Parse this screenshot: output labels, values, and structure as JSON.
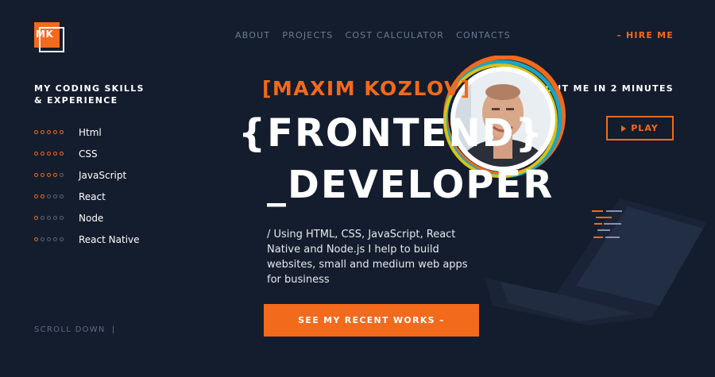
{
  "logo": {
    "text": "MK"
  },
  "nav": {
    "items": [
      "ABOUT",
      "PROJECTS",
      "COST CALCULATOR",
      "CONTACTS"
    ],
    "hire": "– HIRE ME"
  },
  "skills": {
    "title": "MY CODING SKILLS & EXPERIENCE",
    "items": [
      {
        "name": "Html",
        "level": 5
      },
      {
        "name": "CSS",
        "level": 5
      },
      {
        "name": "JavaScript",
        "level": 4
      },
      {
        "name": "React",
        "level": 2
      },
      {
        "name": "Node",
        "level": 1
      },
      {
        "name": "React Native",
        "level": 1
      }
    ],
    "max_level": 5
  },
  "scroll": {
    "label": "SCROLL DOWN",
    "bar": "|"
  },
  "about": {
    "title": "ABOUT ME IN 2 MINUTES",
    "play": "PLAY"
  },
  "hero": {
    "name": "[MAXIM KOZLOV]",
    "line1": "{FRONTEND}",
    "line2": "_DEVELOPER",
    "description": "/ Using HTML, CSS, JavaScript, React Native and Node.js I help to build websites, small and medium web apps for business",
    "cta": "SEE MY RECENT WORKS –"
  },
  "colors": {
    "background": "#141d2e",
    "accent": "#f26a1b",
    "muted": "#6e7a90"
  }
}
